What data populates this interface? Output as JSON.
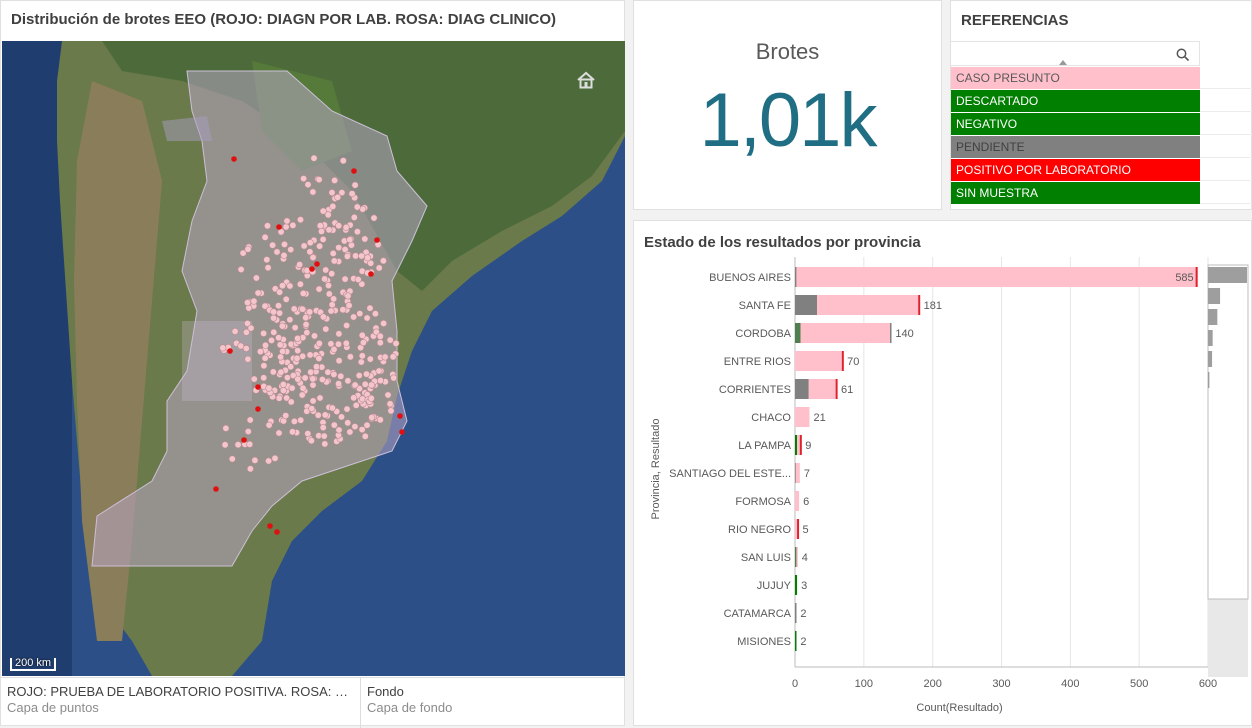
{
  "map": {
    "title": "Distribución de brotes EEO (ROJO: DIAGN POR LAB. ROSA: DIAG CLINICO)",
    "scale_label": "200 km",
    "layers": [
      {
        "name": "ROJO: PRUEBA DE LABORATORIO POSITIVA. ROSA: CASO P...",
        "type": "Capa de puntos"
      },
      {
        "name": "Fondo",
        "type": "Capa de fondo"
      }
    ],
    "icons": {
      "home": "home-icon"
    }
  },
  "kpi": {
    "title": "Brotes",
    "value": "1,01k"
  },
  "references": {
    "title": "REFERENCIAS",
    "items": [
      {
        "label": "CASO PRESUNTO",
        "bg": "#ffc0cb",
        "fg": "#595959"
      },
      {
        "label": "DESCARTADO",
        "bg": "#007f00",
        "fg": "#ffffff"
      },
      {
        "label": "NEGATIVO",
        "bg": "#007f00",
        "fg": "#ffffff"
      },
      {
        "label": "PENDIENTE",
        "bg": "#808080",
        "fg": "#404040"
      },
      {
        "label": "POSITIVO POR LABORATORIO",
        "bg": "#ff0000",
        "fg": "#ffffff"
      },
      {
        "label": "SIN MUESTRA",
        "bg": "#007f00",
        "fg": "#ffffff"
      }
    ]
  },
  "chart_data": {
    "type": "bar",
    "orientation": "horizontal",
    "stacked": true,
    "title": "Estado de los resultados por provincia",
    "xlabel": "Count(Resultado)",
    "ylabel": "Provincia, Resultado",
    "xlim": [
      0,
      600
    ],
    "xticks": [
      0,
      100,
      200,
      300,
      400,
      500,
      600
    ],
    "grid": true,
    "colors": {
      "CASO PRESUNTO": "#ffc0cb",
      "PENDIENTE": "#808080",
      "NEGATIVO": "#4f7f4f",
      "DESCARTADO": "#007f00",
      "POSITIVO POR LABORATORIO": "#e0202a",
      "SIN MUESTRA": "#007f00"
    },
    "categories": [
      "BUENOS AIRES",
      "SANTA FE",
      "CORDOBA",
      "ENTRE RIOS",
      "CORRIENTES",
      "CHACO",
      "LA PAMPA",
      "SANTIAGO DEL ESTE...",
      "FORMOSA",
      "RIO NEGRO",
      "SAN LUIS",
      "JUJUY",
      "CATAMARCA",
      "MISIONES"
    ],
    "totals": [
      585,
      181,
      140,
      70,
      61,
      21,
      9,
      7,
      6,
      5,
      4,
      3,
      2,
      2
    ],
    "segments": [
      [
        {
          "s": "PENDIENTE",
          "v": 2
        },
        {
          "s": "CASO PRESUNTO",
          "v": 580
        },
        {
          "s": "POSITIVO POR LABORATORIO",
          "v": 3
        }
      ],
      [
        {
          "s": "PENDIENTE",
          "v": 32
        },
        {
          "s": "CASO PRESUNTO",
          "v": 147
        },
        {
          "s": "POSITIVO POR LABORATORIO",
          "v": 2
        }
      ],
      [
        {
          "s": "NEGATIVO",
          "v": 8
        },
        {
          "s": "CASO PRESUNTO",
          "v": 130
        },
        {
          "s": "PENDIENTE",
          "v": 2
        }
      ],
      [
        {
          "s": "CASO PRESUNTO",
          "v": 68
        },
        {
          "s": "POSITIVO POR LABORATORIO",
          "v": 2
        }
      ],
      [
        {
          "s": "PENDIENTE",
          "v": 20
        },
        {
          "s": "CASO PRESUNTO",
          "v": 39
        },
        {
          "s": "POSITIVO POR LABORATORIO",
          "v": 2
        }
      ],
      [
        {
          "s": "CASO PRESUNTO",
          "v": 21
        }
      ],
      [
        {
          "s": "DESCARTADO",
          "v": 3
        },
        {
          "s": "CASO PRESUNTO",
          "v": 4
        },
        {
          "s": "POSITIVO POR LABORATORIO",
          "v": 2
        }
      ],
      [
        {
          "s": "PENDIENTE",
          "v": 1
        },
        {
          "s": "CASO PRESUNTO",
          "v": 6
        }
      ],
      [
        {
          "s": "CASO PRESUNTO",
          "v": 6
        }
      ],
      [
        {
          "s": "CASO PRESUNTO",
          "v": 3
        },
        {
          "s": "POSITIVO POR LABORATORIO",
          "v": 2
        }
      ],
      [
        {
          "s": "NEGATIVO",
          "v": 2
        },
        {
          "s": "CASO PRESUNTO",
          "v": 2
        }
      ],
      [
        {
          "s": "DESCARTADO",
          "v": 3
        }
      ],
      [
        {
          "s": "PENDIENTE",
          "v": 2
        }
      ],
      [
        {
          "s": "DESCARTADO",
          "v": 2
        }
      ]
    ],
    "mini_bars": [
      585,
      181,
      140,
      70,
      61,
      21
    ]
  }
}
